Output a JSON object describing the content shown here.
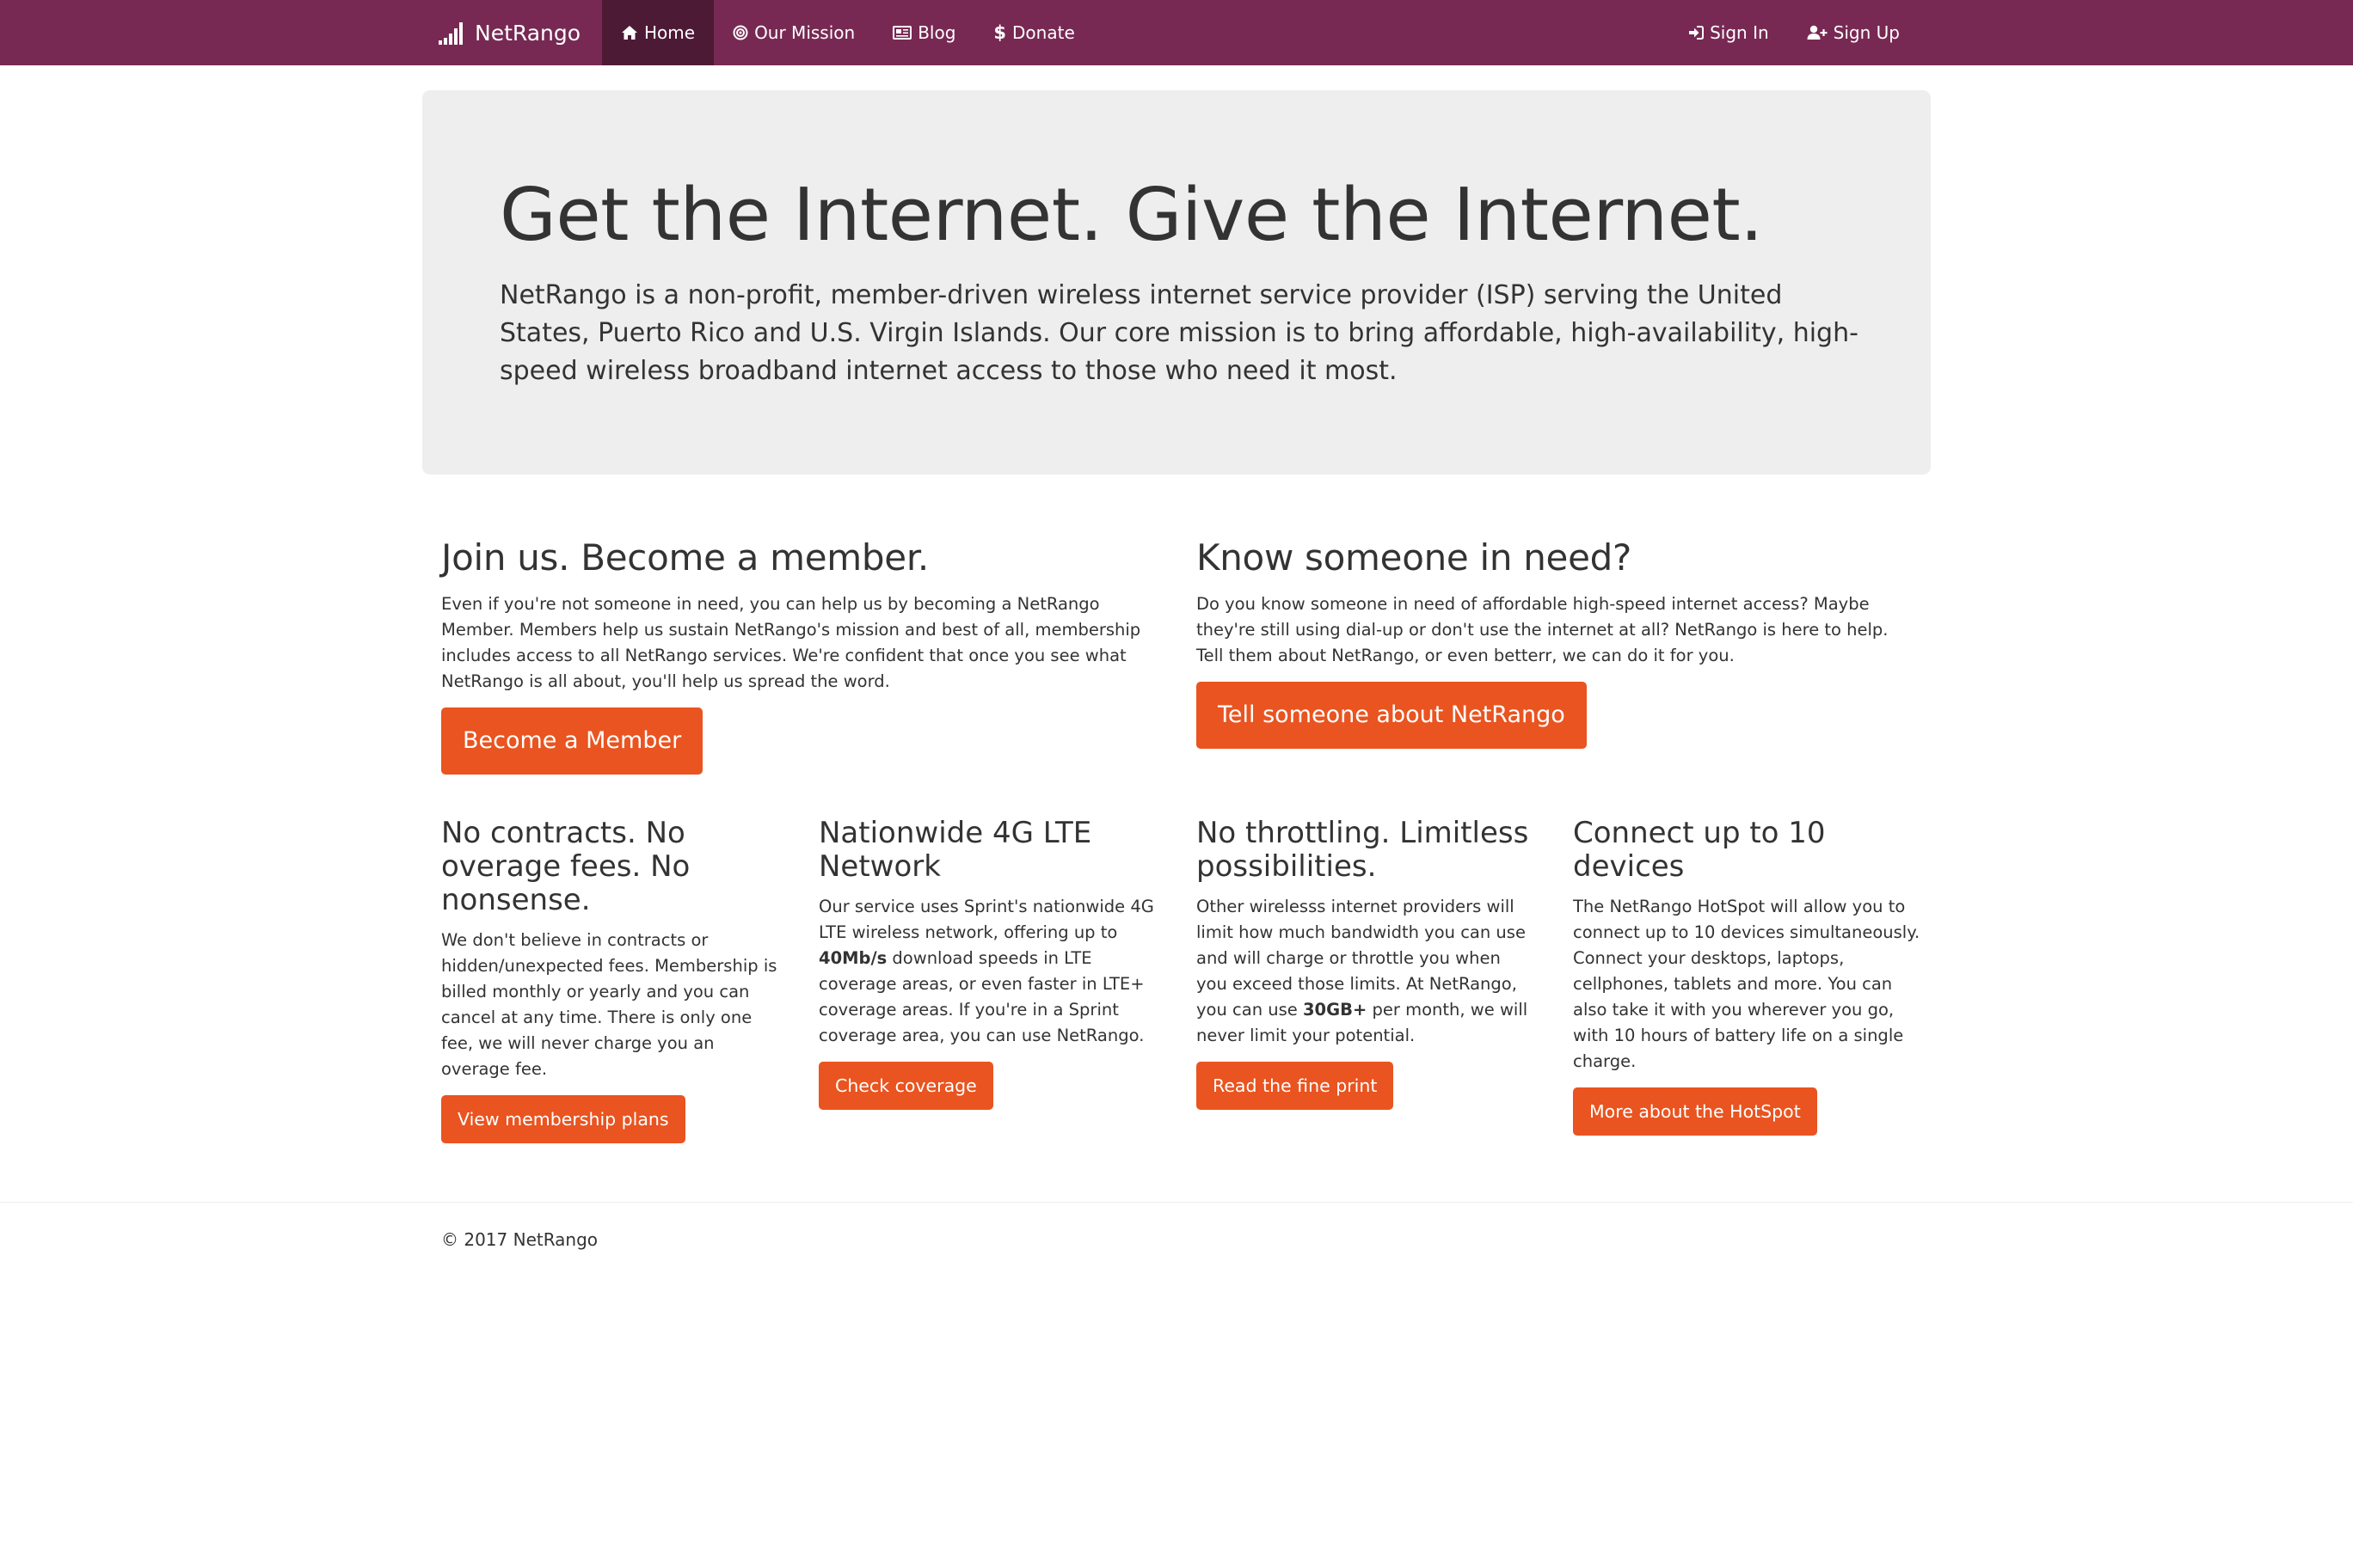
{
  "navbar": {
    "brand": "NetRango",
    "brand_icon": "signal-bars-icon",
    "left_items": [
      {
        "label": "Home",
        "icon": "home-icon",
        "active": true
      },
      {
        "label": "Our Mission",
        "icon": "target-icon"
      },
      {
        "label": "Blog",
        "icon": "newspaper-icon"
      },
      {
        "label": "Donate",
        "icon": "dollar-icon"
      }
    ],
    "right_items": [
      {
        "label": "Sign In",
        "icon": "sign-in-icon"
      },
      {
        "label": "Sign Up",
        "icon": "user-plus-icon"
      }
    ]
  },
  "jumbotron": {
    "heading": "Get the Internet. Give the Internet.",
    "text": "NetRango is a non-profit, member-driven wireless internet service provider (ISP) serving the United States, Puerto Rico and U.S. Virgin Islands. Our core mission is to bring affordable, high-availability, high-speed wireless broadband internet access to those who need it most."
  },
  "sections": {
    "member": {
      "heading": "Join us. Become a member.",
      "text": "Even if you're not someone in need, you can help us by becoming a NetRango Member. Members help us sustain NetRango's mission and best of all, membership includes access to all NetRango services. We're confident that once you see what NetRango is all about, you'll help us spread the word.",
      "button": "Become a Member"
    },
    "need": {
      "heading": "Know someone in need?",
      "text": "Do you know someone in need of affordable high-speed internet access? Maybe they're still using dial-up or don't use the internet at all? NetRango is here to help. Tell them about NetRango, or even betterr, we can do it for you.",
      "button": "Tell someone about NetRango"
    }
  },
  "features": [
    {
      "heading": "No contracts. No overage fees. No nonsense.",
      "text": "We don't believe in contracts or hidden/unexpected fees. Membership is billed monthly or yearly and you can cancel at any time. There is only one fee, we will never charge you an overage fee.",
      "button": "View membership plans"
    },
    {
      "heading": "Nationwide 4G LTE Network",
      "text_before": "Our service uses Sprint's nationwide 4G LTE wireless network, offering up to ",
      "text_bold": "40Mb/s",
      "text_after": " download speeds in LTE coverage areas, or even faster in LTE+ coverage areas. If you're in a Sprint coverage area, you can use NetRango.",
      "button": "Check coverage"
    },
    {
      "heading": "No throttling. Limitless possibilities.",
      "text_before": "Other wirelesss internet providers will limit how much bandwidth you can use and will charge or throttle you when you exceed those limits. At NetRango, you can use ",
      "text_bold": "30GB+",
      "text_after": " per month, we will never limit your potential.",
      "button": "Read the fine print"
    },
    {
      "heading": "Connect up to 10 devices",
      "text": "The NetRango HotSpot will allow you to connect up to 10 devices simultaneously. Connect your desktops, laptops, cellphones, tablets and more. You can also take it with you wherever you go, with 10 hours of battery life on a single charge.",
      "button": "More about the HotSpot"
    }
  ],
  "footer": {
    "copyright": "© 2017 NetRango"
  },
  "colors": {
    "navbar": "#772953",
    "navbar_active": "#4d1a36",
    "accent": "#e95420",
    "jumbotron_bg": "#eeeeee",
    "text": "#333333"
  }
}
